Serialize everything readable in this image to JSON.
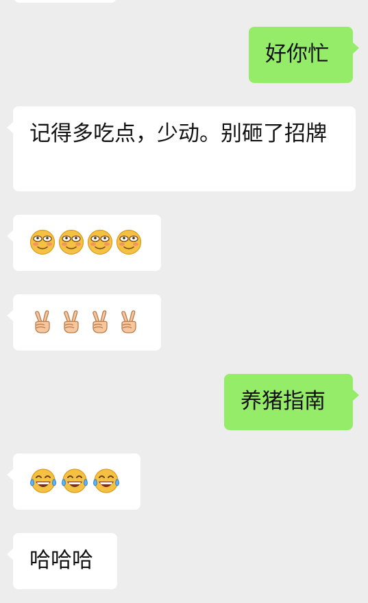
{
  "messages": [
    {
      "side": "right",
      "text": "好你忙"
    },
    {
      "side": "left",
      "text": "记得多吃点，少动。别砸了招牌"
    },
    {
      "side": "left",
      "emoji": "blush-smile-emoji",
      "count": 4
    },
    {
      "side": "left",
      "emoji": "victory-hand-emoji",
      "count": 4
    },
    {
      "side": "right",
      "text": "养猪指南"
    },
    {
      "side": "left",
      "emoji": "tears-of-joy-emoji",
      "count": 3
    },
    {
      "side": "left",
      "text": "哈哈哈"
    }
  ],
  "colors": {
    "background": "#ededed",
    "incoming_bubble": "#ffffff",
    "outgoing_bubble": "#95ec69",
    "text": "#111111"
  }
}
